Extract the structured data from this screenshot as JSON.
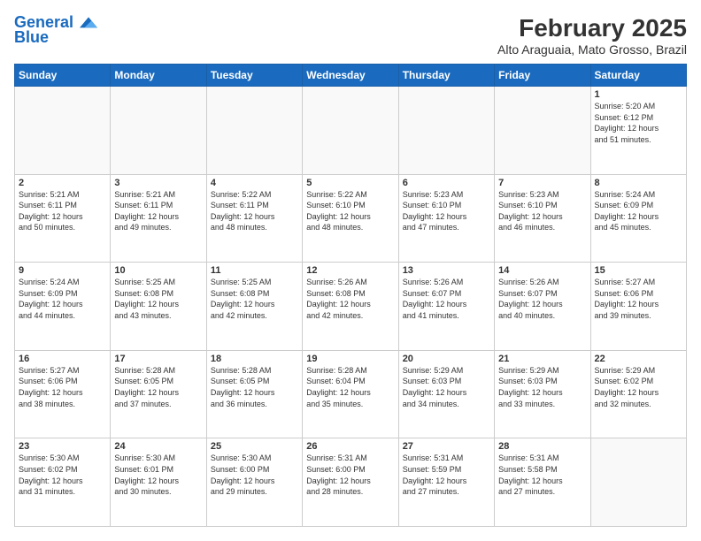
{
  "logo": {
    "line1": "General",
    "line2": "Blue"
  },
  "title": "February 2025",
  "subtitle": "Alto Araguaia, Mato Grosso, Brazil",
  "weekdays": [
    "Sunday",
    "Monday",
    "Tuesday",
    "Wednesday",
    "Thursday",
    "Friday",
    "Saturday"
  ],
  "weeks": [
    [
      {
        "day": "",
        "info": ""
      },
      {
        "day": "",
        "info": ""
      },
      {
        "day": "",
        "info": ""
      },
      {
        "day": "",
        "info": ""
      },
      {
        "day": "",
        "info": ""
      },
      {
        "day": "",
        "info": ""
      },
      {
        "day": "1",
        "info": "Sunrise: 5:20 AM\nSunset: 6:12 PM\nDaylight: 12 hours\nand 51 minutes."
      }
    ],
    [
      {
        "day": "2",
        "info": "Sunrise: 5:21 AM\nSunset: 6:11 PM\nDaylight: 12 hours\nand 50 minutes."
      },
      {
        "day": "3",
        "info": "Sunrise: 5:21 AM\nSunset: 6:11 PM\nDaylight: 12 hours\nand 49 minutes."
      },
      {
        "day": "4",
        "info": "Sunrise: 5:22 AM\nSunset: 6:11 PM\nDaylight: 12 hours\nand 48 minutes."
      },
      {
        "day": "5",
        "info": "Sunrise: 5:22 AM\nSunset: 6:10 PM\nDaylight: 12 hours\nand 48 minutes."
      },
      {
        "day": "6",
        "info": "Sunrise: 5:23 AM\nSunset: 6:10 PM\nDaylight: 12 hours\nand 47 minutes."
      },
      {
        "day": "7",
        "info": "Sunrise: 5:23 AM\nSunset: 6:10 PM\nDaylight: 12 hours\nand 46 minutes."
      },
      {
        "day": "8",
        "info": "Sunrise: 5:24 AM\nSunset: 6:09 PM\nDaylight: 12 hours\nand 45 minutes."
      }
    ],
    [
      {
        "day": "9",
        "info": "Sunrise: 5:24 AM\nSunset: 6:09 PM\nDaylight: 12 hours\nand 44 minutes."
      },
      {
        "day": "10",
        "info": "Sunrise: 5:25 AM\nSunset: 6:08 PM\nDaylight: 12 hours\nand 43 minutes."
      },
      {
        "day": "11",
        "info": "Sunrise: 5:25 AM\nSunset: 6:08 PM\nDaylight: 12 hours\nand 42 minutes."
      },
      {
        "day": "12",
        "info": "Sunrise: 5:26 AM\nSunset: 6:08 PM\nDaylight: 12 hours\nand 42 minutes."
      },
      {
        "day": "13",
        "info": "Sunrise: 5:26 AM\nSunset: 6:07 PM\nDaylight: 12 hours\nand 41 minutes."
      },
      {
        "day": "14",
        "info": "Sunrise: 5:26 AM\nSunset: 6:07 PM\nDaylight: 12 hours\nand 40 minutes."
      },
      {
        "day": "15",
        "info": "Sunrise: 5:27 AM\nSunset: 6:06 PM\nDaylight: 12 hours\nand 39 minutes."
      }
    ],
    [
      {
        "day": "16",
        "info": "Sunrise: 5:27 AM\nSunset: 6:06 PM\nDaylight: 12 hours\nand 38 minutes."
      },
      {
        "day": "17",
        "info": "Sunrise: 5:28 AM\nSunset: 6:05 PM\nDaylight: 12 hours\nand 37 minutes."
      },
      {
        "day": "18",
        "info": "Sunrise: 5:28 AM\nSunset: 6:05 PM\nDaylight: 12 hours\nand 36 minutes."
      },
      {
        "day": "19",
        "info": "Sunrise: 5:28 AM\nSunset: 6:04 PM\nDaylight: 12 hours\nand 35 minutes."
      },
      {
        "day": "20",
        "info": "Sunrise: 5:29 AM\nSunset: 6:03 PM\nDaylight: 12 hours\nand 34 minutes."
      },
      {
        "day": "21",
        "info": "Sunrise: 5:29 AM\nSunset: 6:03 PM\nDaylight: 12 hours\nand 33 minutes."
      },
      {
        "day": "22",
        "info": "Sunrise: 5:29 AM\nSunset: 6:02 PM\nDaylight: 12 hours\nand 32 minutes."
      }
    ],
    [
      {
        "day": "23",
        "info": "Sunrise: 5:30 AM\nSunset: 6:02 PM\nDaylight: 12 hours\nand 31 minutes."
      },
      {
        "day": "24",
        "info": "Sunrise: 5:30 AM\nSunset: 6:01 PM\nDaylight: 12 hours\nand 30 minutes."
      },
      {
        "day": "25",
        "info": "Sunrise: 5:30 AM\nSunset: 6:00 PM\nDaylight: 12 hours\nand 29 minutes."
      },
      {
        "day": "26",
        "info": "Sunrise: 5:31 AM\nSunset: 6:00 PM\nDaylight: 12 hours\nand 28 minutes."
      },
      {
        "day": "27",
        "info": "Sunrise: 5:31 AM\nSunset: 5:59 PM\nDaylight: 12 hours\nand 27 minutes."
      },
      {
        "day": "28",
        "info": "Sunrise: 5:31 AM\nSunset: 5:58 PM\nDaylight: 12 hours\nand 27 minutes."
      },
      {
        "day": "",
        "info": ""
      }
    ]
  ]
}
